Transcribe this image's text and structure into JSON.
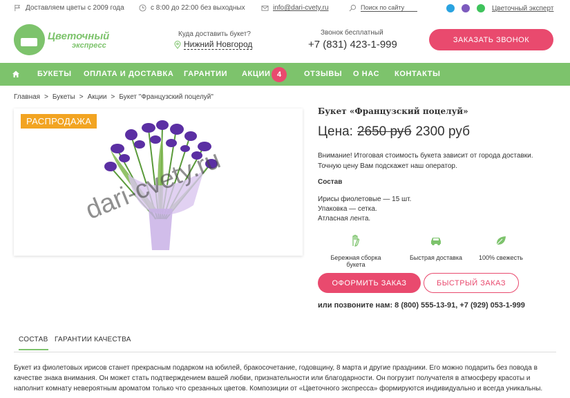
{
  "topbar": {
    "since": "Доставляем цветы с 2009 года",
    "hours": "с 8:00 до 22:00 без выходных",
    "email": "info@dari-cvety.ru",
    "search": "Поиск по сайту",
    "express": "Цветочный эксперт"
  },
  "header": {
    "logo_title": "Цветочный",
    "logo_sub": "экспресс",
    "delivery_question": "Куда доставить букет?",
    "delivery_city": "Нижний Новгород",
    "call_free": "Звонок бесплатный",
    "phone": "+7 (831) 423-1-999",
    "order_call": "ЗАКАЗАТЬ ЗВОНОК"
  },
  "nav": {
    "items": [
      "БУКЕТЫ",
      "ОПЛАТА И ДОСТАВКА",
      "ГАРАНТИИ",
      "АКЦИИ",
      "ОТЗЫВЫ",
      "О НАС",
      "КОНТАКТЫ"
    ],
    "badge": "4"
  },
  "breadcrumbs": [
    "Главная",
    ">",
    "Букеты",
    ">",
    "Акции",
    ">",
    "Букет \"Французский поцелуй\""
  ],
  "product": {
    "sale": "РАСПРОДАЖА",
    "watermark": "dari-cvety.ru",
    "title": "Букет «Французский поцелуй»",
    "price_label": "Цена:",
    "old_price": "2650 руб",
    "new_price": "2300 руб",
    "note_1": "Внимание! Итоговая стоимость букета зависит от города доставки.",
    "note_2": "Точную цену Вам подскажет наш оператор.",
    "composition_title": "Состав",
    "composition": [
      "Ирисы фиолетовые — 15 шт.",
      "Упаковка — сетка.",
      "Атласная лента."
    ],
    "features": [
      "Бережная сборка букета",
      "Быстрая доставка",
      "100% свежесть"
    ],
    "order_button": "ОФОРМИТЬ ЗАКАЗ",
    "quick_button": "БЫСТРЫЙ ЗАКАЗ",
    "call_us": "или позвоните нам: 8 (800) 555-13-91, +7 (929) 053-1-999"
  },
  "tabs": [
    "СОСТАВ",
    "ГАРАНТИИ КАЧЕСТВА"
  ],
  "description": "Букет из фиолетовых ирисов станет прекрасным подарком на юбилей, бракосочетание, годовщину, 8 марта и другие праздники. Его можно подарить без повода в качестве знака внимания. Он может стать подтверждением вашей любви, признательности или благодарности. Он погрузит получателя в атмосферу красоты и наполнит комнату невероятным ароматом только что срезанных цветов. Композиции от «Цветочного экспресса» формируются индивидуально и всегда уникальны.",
  "colors": {
    "green": "#7dc36c",
    "pink": "#e94a6e",
    "orange": "#f2a422"
  }
}
